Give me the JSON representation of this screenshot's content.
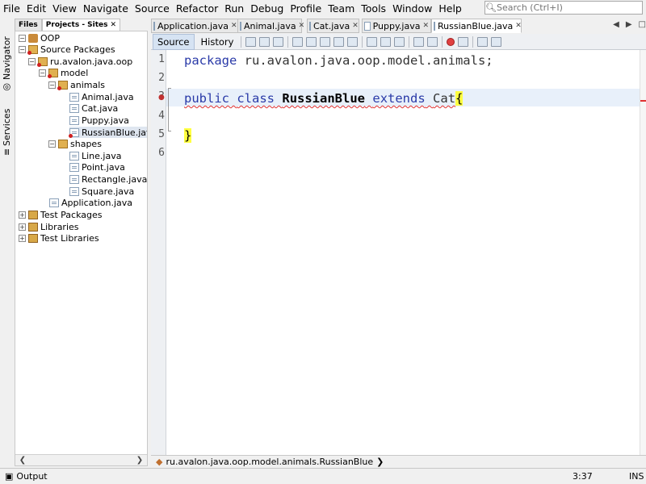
{
  "menu": [
    "File",
    "Edit",
    "View",
    "Navigate",
    "Source",
    "Refactor",
    "Run",
    "Debug",
    "Profile",
    "Team",
    "Tools",
    "Window",
    "Help"
  ],
  "search": {
    "placeholder": "Search (Ctrl+I)"
  },
  "side_tabs": {
    "navigator": "Navigator",
    "services": "Services"
  },
  "panel_tabs": {
    "files": "Files",
    "projects": "Projects - Sites"
  },
  "tree": [
    {
      "label": "OOP"
    },
    {
      "label": "Source Packages"
    },
    {
      "label": "ru.avalon.java.oop"
    },
    {
      "label": "model"
    },
    {
      "label": "animals"
    },
    {
      "label": "Animal.java"
    },
    {
      "label": "Cat.java"
    },
    {
      "label": "Puppy.java"
    },
    {
      "label": "RussianBlue.java"
    },
    {
      "label": "shapes"
    },
    {
      "label": "Line.java"
    },
    {
      "label": "Point.java"
    },
    {
      "label": "Rectangle.java"
    },
    {
      "label": "Square.java"
    },
    {
      "label": "Application.java"
    },
    {
      "label": "Test Packages"
    },
    {
      "label": "Libraries"
    },
    {
      "label": "Test Libraries"
    }
  ],
  "editor_tabs": [
    "Application.java",
    "Animal.java",
    "Cat.java",
    "Puppy.java",
    "RussianBlue.java"
  ],
  "view_buttons": {
    "source": "Source",
    "history": "History"
  },
  "line_numbers": [
    "1",
    "2",
    "3",
    "4",
    "5",
    "6"
  ],
  "code": {
    "l1_kw": "package",
    "l1_rest": " ru.avalon.java.oop.model.animals;",
    "l3_public": "public",
    "l3_class": "class",
    "l3_name": "RussianBlue",
    "l3_extends": "extends",
    "l3_super": "Cat",
    "l3_brace": "{",
    "l5_brace": "}"
  },
  "breadcrumb": "ru.avalon.java.oop.model.animals.RussianBlue",
  "status": {
    "output": "Output",
    "position": "3:37",
    "mode": "INS"
  }
}
